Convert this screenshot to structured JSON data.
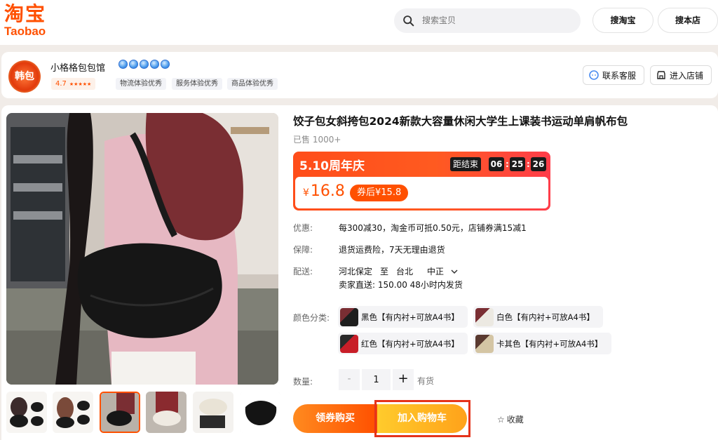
{
  "header": {
    "logo_cn": "淘宝",
    "logo_en": "Taobao",
    "search_placeholder": "搜索宝贝",
    "search_taobao": "搜淘宝",
    "search_store": "搜本店"
  },
  "shop": {
    "avatar_text": "韩包",
    "name": "小格格包包馆",
    "crown_count": 5,
    "score": "4.7",
    "stars": "★★★★★",
    "tags": [
      "物流体验优秀",
      "服务体验优秀",
      "商品体验优秀"
    ],
    "contact_label": "联系客服",
    "enter_label": "进入店铺"
  },
  "product": {
    "title": "饺子包女斜挎包2024新款大容量休闲大学生上课装书运动单肩帆布包",
    "sold": "已售 1000+",
    "promo": {
      "name": "5.10周年庆",
      "ends_label": "距结束",
      "hh": "06",
      "mm": "25",
      "ss": "26",
      "currency": "¥",
      "price": "16.8",
      "coupon_price": "券后¥15.8"
    },
    "rows": {
      "discount_label": "优惠:",
      "discount_value": "每300减30，淘金币可抵0.50元，店铺券满15减1",
      "guarantee_label": "保障:",
      "guarantee_value": "退货运费险，7天无理由退货",
      "shipping_label": "配送:",
      "ship_from": "河北保定",
      "ship_to_word": "至",
      "ship_city": "台北",
      "ship_district": "中正",
      "ship_detail": "卖家直送: 150.00  48小时内发货"
    },
    "color_label": "颜色分类:",
    "colors": [
      {
        "label": "黑色【有内衬+可放A4书】",
        "tone": "#1e1e1e"
      },
      {
        "label": "白色【有内衬+可放A4书】",
        "tone": "#ece9e2"
      },
      {
        "label": "红色【有内衬+可放A4书】",
        "tone": "#c81e28"
      },
      {
        "label": "卡其色【有内衬+可放A4书】",
        "tone": "#d4c5a4"
      }
    ],
    "quantity_label": "数量:",
    "quantity": "1",
    "qty_minus": "-",
    "qty_plus": "+",
    "stock": "有货",
    "buy_label": "领券购买",
    "cart_label": "加入购物车",
    "favorite_label": "收藏",
    "favorite_icon": "☆"
  },
  "colors": {
    "brand": "#ff5000",
    "promo_red": "#ff4d1a",
    "cart_yellow": "#ffb020",
    "highlight": "#e5331b"
  }
}
